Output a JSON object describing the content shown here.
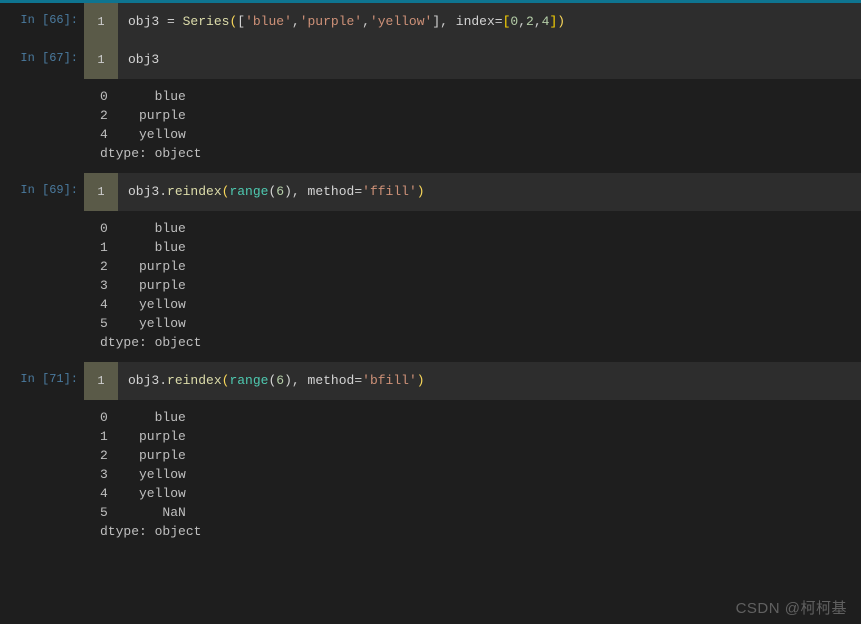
{
  "topbar": {},
  "cells": [
    {
      "prompt": "In [66]:",
      "lineno": "1",
      "code_tokens": [
        {
          "cls": "t-ident",
          "t": "obj3 "
        },
        {
          "cls": "t-op",
          "t": "= "
        },
        {
          "cls": "t-call",
          "t": "Series"
        },
        {
          "cls": "t-punc",
          "t": "("
        },
        {
          "cls": "t-brk",
          "t": "["
        },
        {
          "cls": "t-str",
          "t": "'blue'"
        },
        {
          "cls": "t-op",
          "t": ","
        },
        {
          "cls": "t-str",
          "t": "'purple'"
        },
        {
          "cls": "t-op",
          "t": ","
        },
        {
          "cls": "t-str",
          "t": "'yellow'"
        },
        {
          "cls": "t-brk",
          "t": "]"
        },
        {
          "cls": "t-op",
          "t": ", "
        },
        {
          "cls": "t-ident",
          "t": "index"
        },
        {
          "cls": "t-op",
          "t": "="
        },
        {
          "cls": "t-brk2",
          "t": "["
        },
        {
          "cls": "t-num",
          "t": "0"
        },
        {
          "cls": "t-op",
          "t": ","
        },
        {
          "cls": "t-num",
          "t": "2"
        },
        {
          "cls": "t-op",
          "t": ","
        },
        {
          "cls": "t-num",
          "t": "4"
        },
        {
          "cls": "t-brk2",
          "t": "]"
        },
        {
          "cls": "t-punc",
          "t": ")"
        }
      ],
      "output": null
    },
    {
      "prompt": "In [67]:",
      "lineno": "1",
      "code_tokens": [
        {
          "cls": "t-ident",
          "t": "obj3"
        }
      ],
      "output": "0      blue\n2    purple\n4    yellow\ndtype: object"
    },
    {
      "prompt": "In [69]:",
      "lineno": "1",
      "code_tokens": [
        {
          "cls": "t-ident",
          "t": "obj3"
        },
        {
          "cls": "t-op",
          "t": "."
        },
        {
          "cls": "t-call",
          "t": "reindex"
        },
        {
          "cls": "t-punc",
          "t": "("
        },
        {
          "cls": "t-call2",
          "t": "range"
        },
        {
          "cls": "t-brk",
          "t": "("
        },
        {
          "cls": "t-num",
          "t": "6"
        },
        {
          "cls": "t-brk",
          "t": ")"
        },
        {
          "cls": "t-op",
          "t": ", "
        },
        {
          "cls": "t-ident",
          "t": "method"
        },
        {
          "cls": "t-op",
          "t": "="
        },
        {
          "cls": "t-str",
          "t": "'ffill'"
        },
        {
          "cls": "t-punc",
          "t": ")"
        }
      ],
      "output": "0      blue\n1      blue\n2    purple\n3    purple\n4    yellow\n5    yellow\ndtype: object"
    },
    {
      "prompt": "In [71]:",
      "lineno": "1",
      "code_tokens": [
        {
          "cls": "t-ident",
          "t": "obj3"
        },
        {
          "cls": "t-op",
          "t": "."
        },
        {
          "cls": "t-call",
          "t": "reindex"
        },
        {
          "cls": "t-punc",
          "t": "("
        },
        {
          "cls": "t-call2",
          "t": "range"
        },
        {
          "cls": "t-brk",
          "t": "("
        },
        {
          "cls": "t-num",
          "t": "6"
        },
        {
          "cls": "t-brk",
          "t": ")"
        },
        {
          "cls": "t-op",
          "t": ", "
        },
        {
          "cls": "t-ident",
          "t": "method"
        },
        {
          "cls": "t-op",
          "t": "="
        },
        {
          "cls": "t-str",
          "t": "'bfill'"
        },
        {
          "cls": "t-punc",
          "t": ")"
        }
      ],
      "output": "0      blue\n1    purple\n2    purple\n3    yellow\n4    yellow\n5       NaN\ndtype: object"
    }
  ],
  "watermark": "CSDN @柯柯基",
  "chart_data": {
    "type": "table",
    "description": "pandas Series reindex with ffill/bfill",
    "original_series": {
      "index": [
        0,
        2,
        4
      ],
      "values": [
        "blue",
        "purple",
        "yellow"
      ],
      "dtype": "object"
    },
    "reindex_ffill": {
      "index": [
        0,
        1,
        2,
        3,
        4,
        5
      ],
      "values": [
        "blue",
        "blue",
        "purple",
        "purple",
        "yellow",
        "yellow"
      ],
      "dtype": "object"
    },
    "reindex_bfill": {
      "index": [
        0,
        1,
        2,
        3,
        4,
        5
      ],
      "values": [
        "blue",
        "purple",
        "purple",
        "yellow",
        "yellow",
        "NaN"
      ],
      "dtype": "object"
    }
  }
}
